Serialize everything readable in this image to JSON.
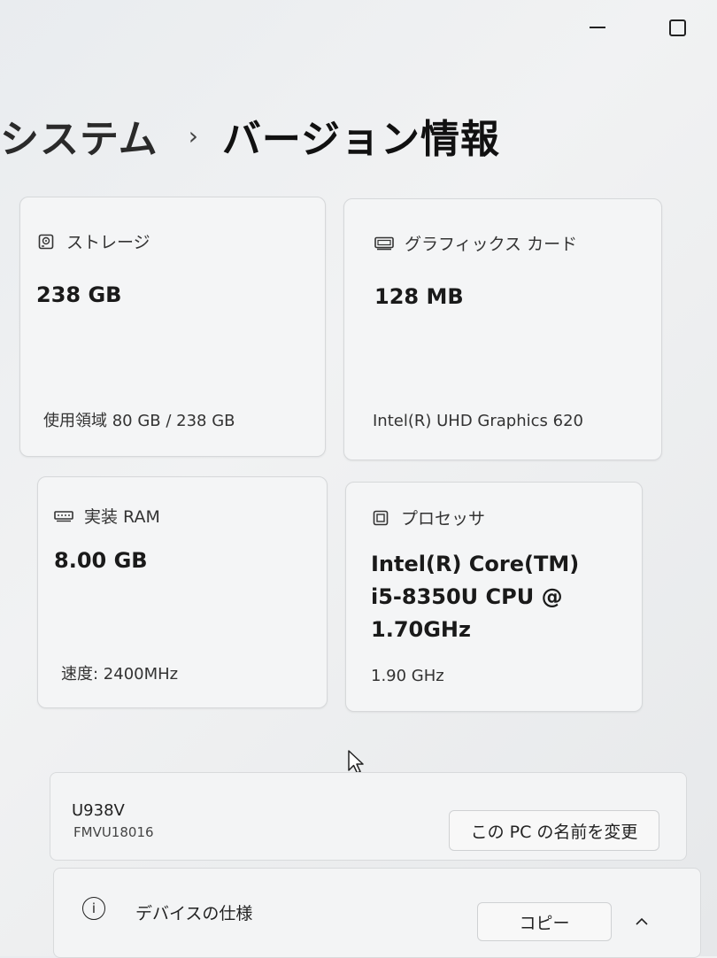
{
  "breadcrumb": {
    "parent": "システム",
    "separator": "›",
    "current": "バージョン情報"
  },
  "cards": {
    "storage": {
      "label": "ストレージ",
      "value": "238 GB",
      "detail": "使用領域 80 GB / 238 GB",
      "icon": "storage-icon"
    },
    "graphics": {
      "label": "グラフィックス カード",
      "value": "128 MB",
      "detail": "Intel(R) UHD Graphics 620",
      "icon": "graphics-card-icon"
    },
    "ram": {
      "label": "実装 RAM",
      "value": "8.00 GB",
      "detail": "速度: 2400MHz",
      "icon": "memory-icon"
    },
    "cpu": {
      "label": "プロセッサ",
      "value_lines": [
        "Intel(R) Core(TM)",
        "i5-8350U CPU @",
        "1.70GHz"
      ],
      "detail": "1.90 GHz",
      "icon": "processor-icon"
    }
  },
  "device": {
    "model": "U938V",
    "id": "FMVU18016",
    "rename_label": "この PC の名前を変更"
  },
  "specs": {
    "label": "デバイスの仕様",
    "copy_label": "コピー"
  }
}
